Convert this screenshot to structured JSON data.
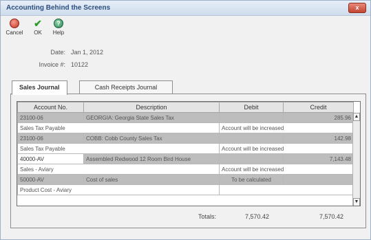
{
  "window": {
    "title": "Accounting Behind the Screens",
    "close_label": "x"
  },
  "toolbar": {
    "cancel_label": "Cancel",
    "ok_label": "OK",
    "help_label": "Help",
    "help_glyph": "?"
  },
  "fields": {
    "date_label": "Date:",
    "date_value": "Jan 1, 2012",
    "invoice_label": "Invoice #:",
    "invoice_value": "10122"
  },
  "tabs": [
    "Sales Journal",
    "Cash Receipts Journal"
  ],
  "grid": {
    "headers": [
      "Account No.",
      "Description",
      "Debit",
      "Credit"
    ],
    "rows": [
      {
        "account": "23100-06",
        "description": "GEORGIA: Georgia State Sales Tax",
        "debit": "",
        "credit": "285.96",
        "note_left": "Sales Tax Payable",
        "note_right": "Account will be increased"
      },
      {
        "account": "23100-06",
        "description": "COBB: Cobb County Sales Tax",
        "debit": "",
        "credit": "142.98",
        "note_left": "Sales Tax Payable",
        "note_right": "Account will be increased"
      },
      {
        "account": "40000-AV",
        "description": "Assembled Redwood 12 Room Bird House",
        "debit": "",
        "credit": "7,143.48",
        "note_left": "Sales - Aviary",
        "note_right": "Account will be increased"
      },
      {
        "account": "50000-AV",
        "description": "Cost of sales",
        "debit": "To be calculated",
        "credit": "",
        "note_left": "Product Cost - Aviary",
        "note_right": ""
      }
    ]
  },
  "totals": {
    "label": "Totals:",
    "debit": "7,570.42",
    "credit": "7,570.42"
  }
}
